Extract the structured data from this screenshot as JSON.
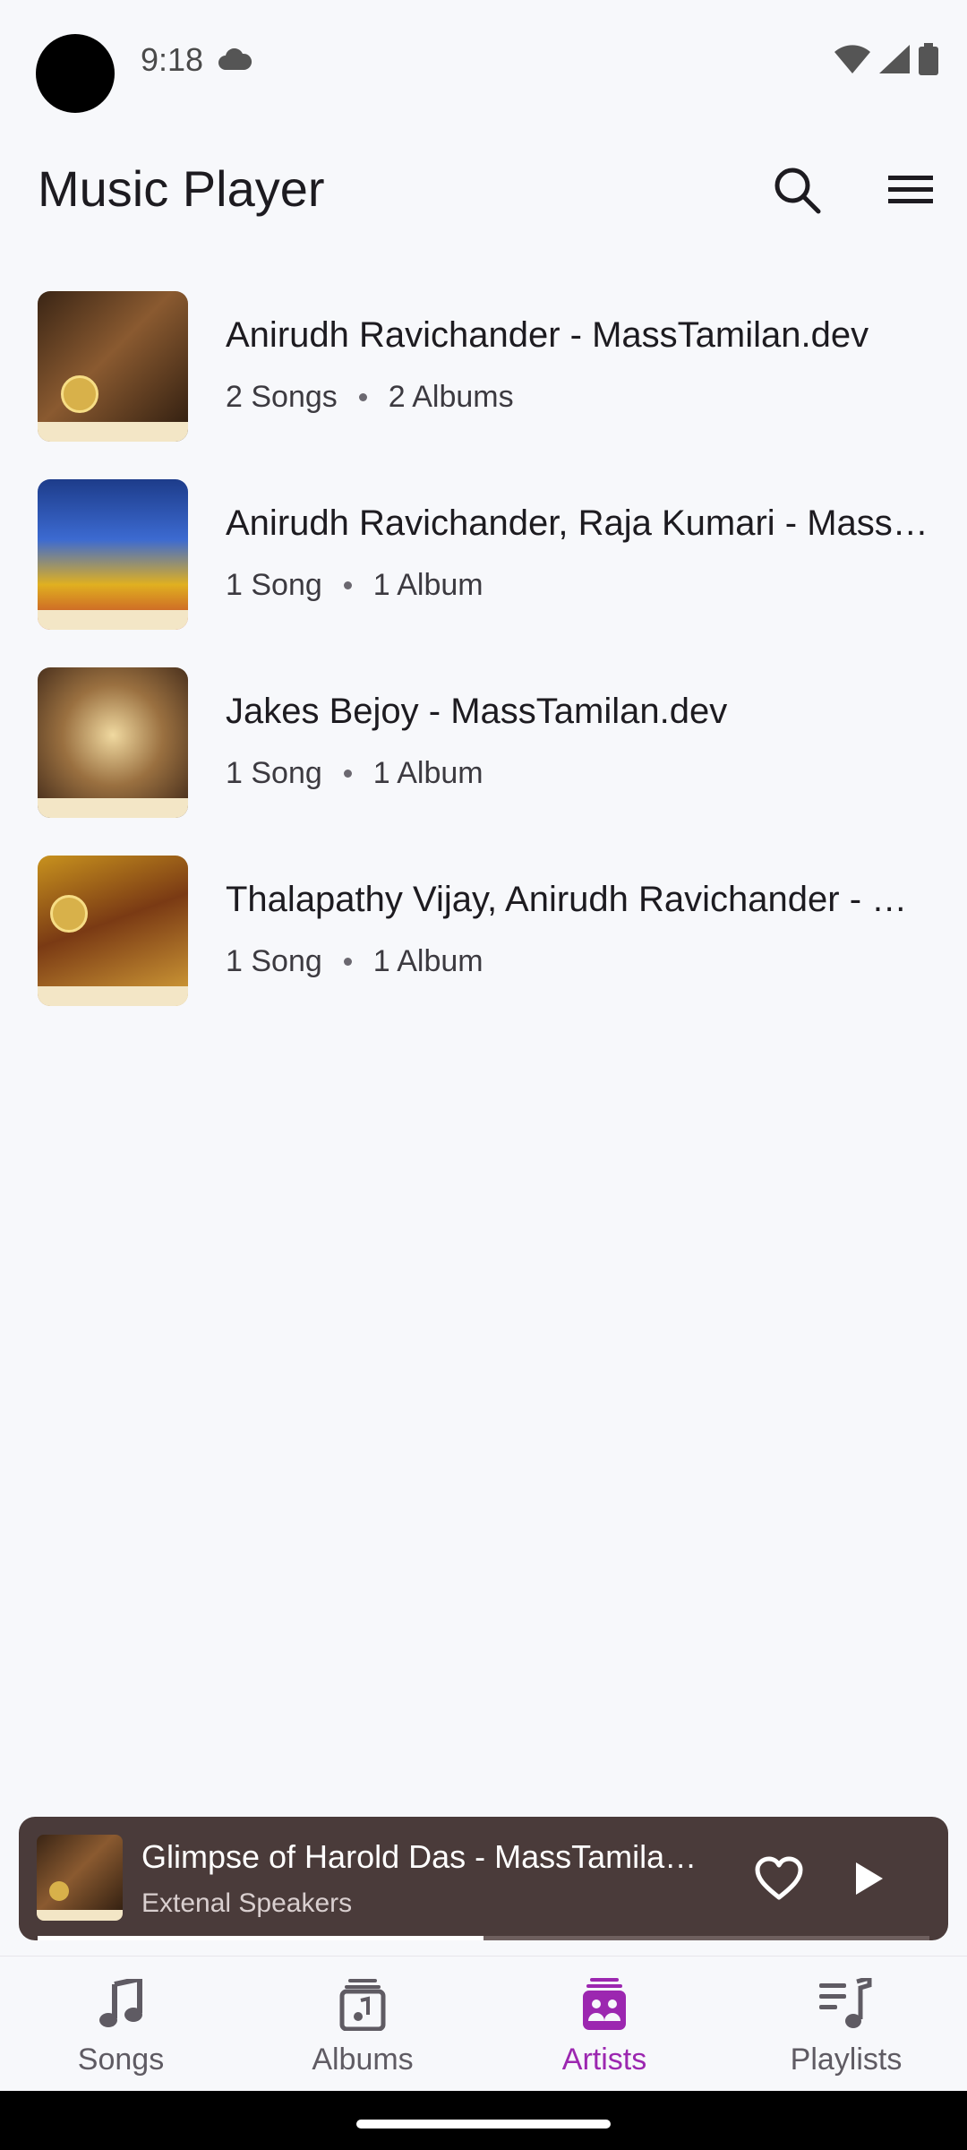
{
  "status_bar": {
    "time": "9:18"
  },
  "app_bar": {
    "title": "Music Player"
  },
  "artists": [
    {
      "name": "Anirudh Ravichander - MassTamilan.dev",
      "songs": "2 Songs",
      "albums": "2 Albums"
    },
    {
      "name": "Anirudh Ravichander, Raja Kumari - MassTamilan.dev",
      "songs": "1 Song",
      "albums": "1 Album"
    },
    {
      "name": "Jakes Bejoy - MassTamilan.dev",
      "songs": "1 Song",
      "albums": "1 Album"
    },
    {
      "name": "Thalapathy Vijay, Anirudh Ravichander - MassTamilan.dev",
      "songs": "1 Song",
      "albums": "1 Album"
    }
  ],
  "now_playing": {
    "title": "Glimpse of Harold Das - MassTamilan.dev",
    "output": "Extenal Speakers",
    "progress": 0.5
  },
  "bottom_nav": [
    {
      "label": "Songs",
      "icon": "music-note-icon"
    },
    {
      "label": "Albums",
      "icon": "album-icon"
    },
    {
      "label": "Artists",
      "icon": "artists-icon",
      "active": true
    },
    {
      "label": "Playlists",
      "icon": "playlist-icon"
    }
  ],
  "colors": {
    "accent": "#9c27b0",
    "mini_player_bg": "#4a3b3a",
    "background": "#f7f8fb"
  }
}
